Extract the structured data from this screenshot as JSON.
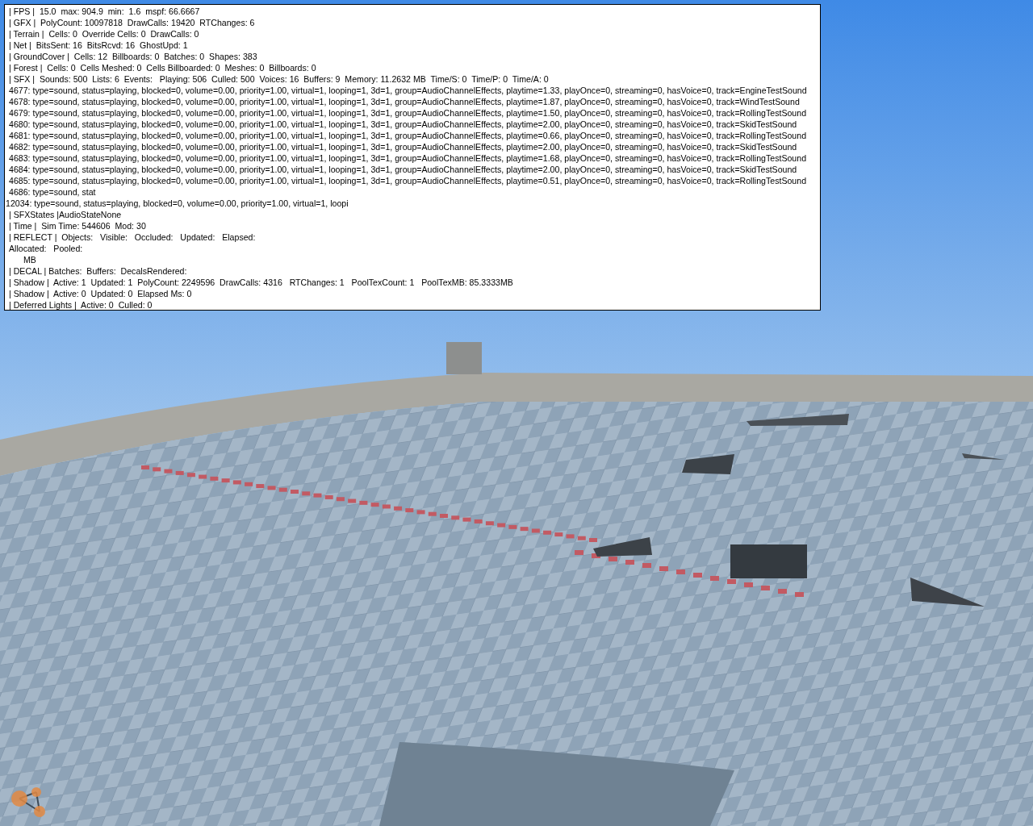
{
  "debug_overlay": {
    "lines": [
      {
        "kind": "stat",
        "text": "| FPS |  15.0  max: 904.9  min:  1.6  mspf: 66.6667"
      },
      {
        "kind": "stat",
        "text": "| GFX |  PolyCount: 10097818  DrawCalls: 19420  RTChanges: 6"
      },
      {
        "kind": "stat",
        "text": "| Terrain |  Cells: 0  Override Cells: 0  DrawCalls: 0"
      },
      {
        "kind": "stat",
        "text": "| Net |  BitsSent: 16  BitsRcvd: 16  GhostUpd: 1"
      },
      {
        "kind": "stat",
        "text": "| GroundCover |  Cells: 12  Billboards: 0  Batches: 0  Shapes: 383"
      },
      {
        "kind": "stat",
        "text": "| Forest |  Cells: 0  Cells Meshed: 0  Cells Billboarded: 0  Meshes: 0  Billboards: 0"
      },
      {
        "kind": "stat",
        "text": "| SFX |  Sounds: 500  Lists: 6  Events:   Playing: 506  Culled: 500  Voices: 16  Buffers: 9  Memory: 11.2632 MB  Time/S: 0  Time/P: 0  Time/A: 0"
      },
      {
        "kind": "sound",
        "text": "4677: type=sound, status=playing, blocked=0, volume=0.00, priority=1.00, virtual=1, looping=1, 3d=1, group=AudioChannelEffects, playtime=1.33, playOnce=0, streaming=0, hasVoice=0, track=EngineTestSound"
      },
      {
        "kind": "sound",
        "text": "4678: type=sound, status=playing, blocked=0, volume=0.00, priority=1.00, virtual=1, looping=1, 3d=1, group=AudioChannelEffects, playtime=1.87, playOnce=0, streaming=0, hasVoice=0, track=WindTestSound"
      },
      {
        "kind": "sound",
        "text": "4679: type=sound, status=playing, blocked=0, volume=0.00, priority=1.00, virtual=1, looping=1, 3d=1, group=AudioChannelEffects, playtime=1.50, playOnce=0, streaming=0, hasVoice=0, track=RollingTestSound"
      },
      {
        "kind": "sound",
        "text": "4680: type=sound, status=playing, blocked=0, volume=0.00, priority=1.00, virtual=1, looping=1, 3d=1, group=AudioChannelEffects, playtime=2.00, playOnce=0, streaming=0, hasVoice=0, track=SkidTestSound"
      },
      {
        "kind": "sound",
        "text": "4681: type=sound, status=playing, blocked=0, volume=0.00, priority=1.00, virtual=1, looping=1, 3d=1, group=AudioChannelEffects, playtime=0.66, playOnce=0, streaming=0, hasVoice=0, track=RollingTestSound"
      },
      {
        "kind": "sound",
        "text": "4682: type=sound, status=playing, blocked=0, volume=0.00, priority=1.00, virtual=1, looping=1, 3d=1, group=AudioChannelEffects, playtime=2.00, playOnce=0, streaming=0, hasVoice=0, track=SkidTestSound"
      },
      {
        "kind": "sound",
        "text": "4683: type=sound, status=playing, blocked=0, volume=0.00, priority=1.00, virtual=1, looping=1, 3d=1, group=AudioChannelEffects, playtime=1.68, playOnce=0, streaming=0, hasVoice=0, track=RollingTestSound"
      },
      {
        "kind": "sound",
        "text": "4684: type=sound, status=playing, blocked=0, volume=0.00, priority=1.00, virtual=1, looping=1, 3d=1, group=AudioChannelEffects, playtime=2.00, playOnce=0, streaming=0, hasVoice=0, track=SkidTestSound"
      },
      {
        "kind": "sound",
        "text": "4685: type=sound, status=playing, blocked=0, volume=0.00, priority=1.00, virtual=1, looping=1, 3d=1, group=AudioChannelEffects, playtime=0.51, playOnce=0, streaming=0, hasVoice=0, track=RollingTestSound"
      },
      {
        "kind": "sound",
        "text": "4686: type=sound, stat"
      },
      {
        "kind": "overflow",
        "text": "12034: type=sound, status=playing, blocked=0, volume=0.00, priority=1.00, virtual=1, loopi"
      },
      {
        "kind": "stat",
        "text": "| SFXStates |AudioStateNone"
      },
      {
        "kind": "stat",
        "text": "| Time |  Sim Time: 544606  Mod: 30"
      },
      {
        "kind": "stat",
        "text": "| REFLECT |  Objects:   Visible:   Occluded:   Updated:   Elapsed:"
      },
      {
        "kind": "stat",
        "text": "Allocated:   Pooled:"
      },
      {
        "kind": "sub",
        "text": "MB"
      },
      {
        "kind": "stat",
        "text": "| DECAL | Batches:  Buffers:  DecalsRendered:"
      },
      {
        "kind": "stat",
        "text": "| Shadow |  Active: 1  Updated: 1  PolyCount: 2249596  DrawCalls: 4316   RTChanges: 1   PoolTexCount: 1   PoolTexMB: 85.3333MB"
      },
      {
        "kind": "stat",
        "text": "| Shadow |  Active: 0  Updated: 0  Elapsed Ms: 0"
      },
      {
        "kind": "stat",
        "text": "| Deferred Lights |  Active: 0  Culled: 0"
      }
    ]
  }
}
